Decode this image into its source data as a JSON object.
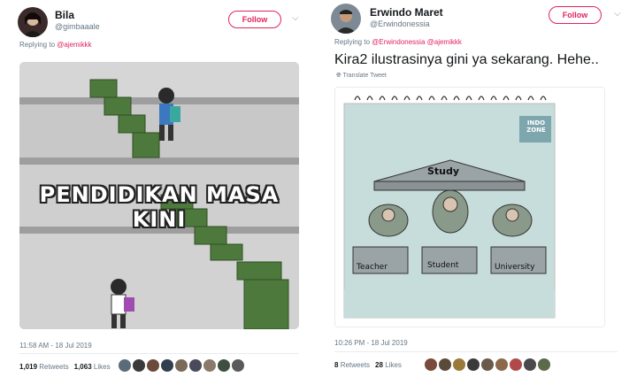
{
  "tweets": [
    {
      "name": "Bila",
      "handle": "@gimbaaale",
      "follow_label": "Follow",
      "replying_prefix": "Replying to ",
      "replying_to": "@ajemikkk",
      "image_caption": "PENDIDIKAN MASA KINI",
      "timestamp": "11:58 AM - 18 Jul 2019",
      "retweets_count": "1,019",
      "retweets_label": "Retweets",
      "likes_count": "1,063",
      "likes_label": "Likes"
    },
    {
      "name": "Erwindo Maret",
      "handle": "@Erwindonessia",
      "follow_label": "Follow",
      "replying_prefix": "Replying to ",
      "replying_to": "@Erwindonessia @ajemikkk",
      "text": "Kira2 ilustrasinya gini ya sekarang. Hehe..",
      "translate": "Translate Tweet",
      "cartoon": {
        "roof": "Study",
        "left": "Teacher",
        "center": "Student",
        "right": "University",
        "watermark": "INDO ZONE"
      },
      "timestamp": "10:26 PM - 18 Jul 2019",
      "retweets_count": "8",
      "retweets_label": "Retweets",
      "likes_count": "28",
      "likes_label": "Likes"
    }
  ],
  "colors": {
    "accent": "#e0245e",
    "muted": "#657786"
  }
}
